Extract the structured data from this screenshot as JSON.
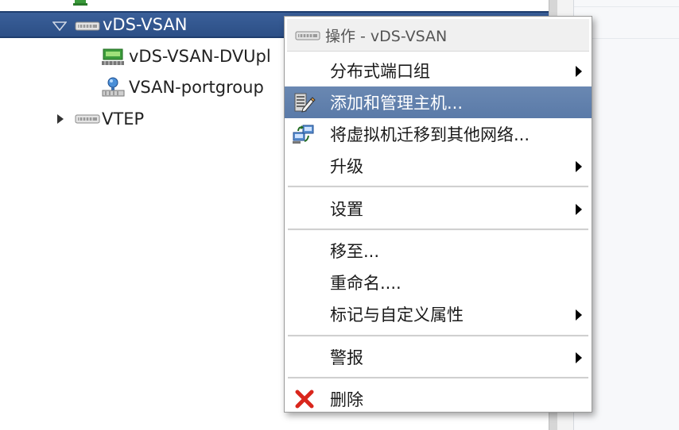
{
  "tree": {
    "items": [
      {
        "label": "vDS-VSAN",
        "expanded": true,
        "selected": true,
        "icon": "distributed-switch-icon"
      },
      {
        "label": "vDS-VSAN-DVUpl",
        "icon": "uplink-portgroup-icon"
      },
      {
        "label": "VSAN-portgroup",
        "icon": "portgroup-icon"
      },
      {
        "label": "VTEP",
        "expanded": false,
        "icon": "distributed-switch-icon"
      }
    ]
  },
  "context_menu": {
    "header": "操作 - vDS-VSAN",
    "header_icon": "distributed-switch-icon",
    "items": [
      {
        "label": "分布式端口组",
        "submenu": true
      },
      {
        "label": "添加和管理主机...",
        "icon": "add-manage-hosts-icon",
        "highlighted": true
      },
      {
        "label": "将虚拟机迁移到其他网络...",
        "icon": "migrate-vm-network-icon"
      },
      {
        "label": "升级",
        "submenu": true
      },
      {
        "label": "设置",
        "submenu": true
      },
      {
        "label": "移至..."
      },
      {
        "label": "重命名...."
      },
      {
        "label": "标记与自定义属性",
        "submenu": true
      },
      {
        "label": "警报",
        "submenu": true
      },
      {
        "label": "删除",
        "icon": "delete-x-icon"
      }
    ]
  },
  "colors": {
    "selection_bg": "#2f5389",
    "hover_bg": "#6282ad",
    "delete_red": "#d9261c"
  }
}
